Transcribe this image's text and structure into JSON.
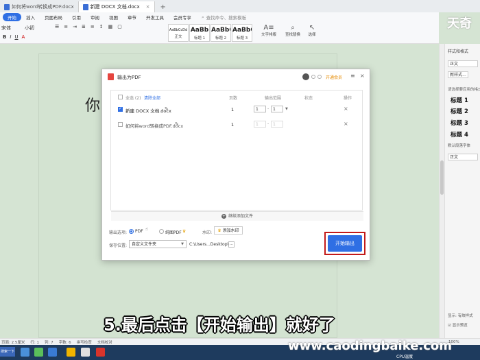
{
  "tabs": [
    {
      "label": "如何将word转换成PDF.docx",
      "active": false
    },
    {
      "label": "新建 DOCX 文档.docx",
      "active": true
    }
  ],
  "menu": {
    "items": [
      "开始",
      "插入",
      "页面布局",
      "引用",
      "审阅",
      "视图",
      "章节",
      "开发工具",
      "会员专享"
    ],
    "search_placeholder": "查找命令、搜索模板"
  },
  "ribbon": {
    "font": "宋体",
    "size": "小初",
    "styles": [
      {
        "sample": "AaBbCcDd",
        "label": "正文"
      },
      {
        "sample": "AaBb",
        "label": "标题 1"
      },
      {
        "sample": "AaBbC",
        "label": "标题 2"
      },
      {
        "sample": "AaBbC",
        "label": "标题 3"
      }
    ],
    "text_layout": "文字排版",
    "find_replace": "查找替换",
    "select": "选择"
  },
  "watermark_logo": "天奇",
  "right_panel": {
    "title": "样式和格式",
    "current_style": "正文",
    "new_style": "新样式...",
    "hint": "请选择要应用的格式",
    "headings": [
      "标题 1",
      "标题 2",
      "标题 3",
      "标题 4"
    ],
    "default_font_label": "默认段落字体",
    "body_style": "正文",
    "show": "显示: 有效样式",
    "preview": "显示预览"
  },
  "document": {
    "text": "你"
  },
  "dialog": {
    "title": "输出为PDF",
    "vip": "开通会员",
    "header": {
      "select_all": "全选 (2)",
      "clear_all": "清除全部",
      "pages": "页数",
      "range": "输出范围",
      "status": "状态",
      "actions": "操作"
    },
    "files": [
      {
        "name": "新建 DOCX 文档.docx",
        "checked": true,
        "pages": "1",
        "from": "1",
        "to": "1"
      },
      {
        "name": "如何将word转换成PDF.docx",
        "checked": false,
        "pages": "1",
        "from": "1",
        "to": "1"
      }
    ],
    "add_files": "继续添加文件",
    "output_label": "输出选项:",
    "opt_pdf": "PDF",
    "opt_image_pdf": "纯图PDF",
    "watermark_label": "水印:",
    "add_watermark": "添加水印",
    "save_label": "保存位置:",
    "save_option": "自定义文件夹",
    "save_path": "C:\\Users...Desktop\\",
    "more": "...",
    "start": "开始输出"
  },
  "caption": "5.最后点击【开始输出】就好了",
  "site_watermark": "www.caodingbaike.com",
  "status": {
    "page_size": "页面: 2.5厘米",
    "row": "行: 1",
    "col": "列: 7",
    "words": "字数: 6",
    "spell": "拼写检查",
    "proof": "文档校对",
    "zoom": "100%"
  },
  "taskbar": {
    "start": "搜索一下",
    "cpu": "CPU温度"
  }
}
